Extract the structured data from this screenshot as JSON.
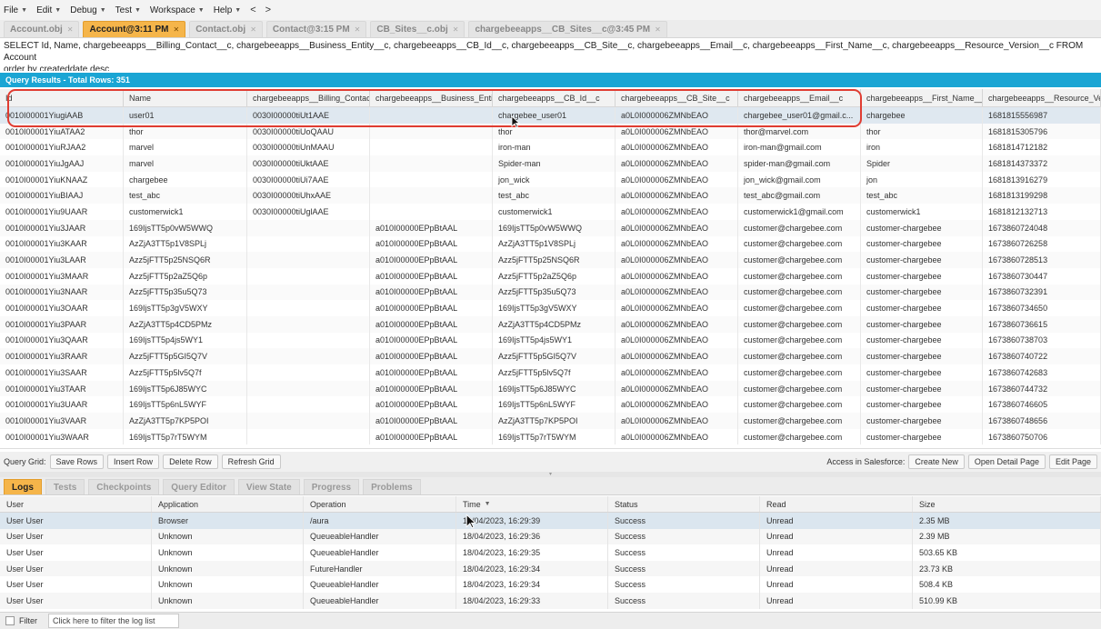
{
  "menu": {
    "items": [
      "File",
      "Edit",
      "Debug",
      "Test",
      "Workspace",
      "Help"
    ],
    "back": "<",
    "forward": ">"
  },
  "tabs": [
    {
      "label": "Account.obj",
      "active": false
    },
    {
      "label": "Account@3:11 PM",
      "active": true
    },
    {
      "label": "Contact.obj",
      "active": false
    },
    {
      "label": "Contact@3:15 PM",
      "active": false
    },
    {
      "label": "CB_Sites__c.obj",
      "active": false
    },
    {
      "label": "chargebeeapps__CB_Sites__c@3:45 PM",
      "active": false
    }
  ],
  "query": {
    "text": "SELECT Id, Name, chargebeeapps__Billing_Contact__c, chargebeeapps__Business_Entity__c, chargebeeapps__CB_Id__c, chargebeeapps__CB_Site__c, chargebeeapps__Email__c, chargebeeapps__First_Name__c, chargebeeapps__Resource_Version__c FROM Account\norder by createddate desc"
  },
  "results": {
    "header": "Query Results - Total Rows: 351",
    "columns": [
      "Id",
      "Name",
      "chargebeeapps__Billing_Contac",
      "chargebeeapps__Business_Enti",
      "chargebeeapps__CB_Id__c",
      "chargebeeapps__CB_Site__c",
      "chargebeeapps__Email__c",
      "chargebeeapps__First_Name__",
      "chargebeeapps__Resource_Ve"
    ],
    "rows": [
      [
        "0010I00001YiugiAAB",
        "user01",
        "0030I00000tiUt1AAE",
        "",
        "chargebee_user01",
        "a0L0I000006ZMNbEAO",
        "chargebee_user01@gmail.c...",
        "chargebee",
        "1681815556987"
      ],
      [
        "0010I00001YiuATAA2",
        "thor",
        "0030I00000tiUoQAAU",
        "",
        "thor",
        "a0L0I000006ZMNbEAO",
        "thor@marvel.com",
        "thor",
        "1681815305796"
      ],
      [
        "0010I00001YiuRJAA2",
        "marvel",
        "0030I00000tiUnMAAU",
        "",
        "iron-man",
        "a0L0I000006ZMNbEAO",
        "iron-man@gmail.com",
        "iron",
        "1681814712182"
      ],
      [
        "0010I00001YiuJgAAJ",
        "marvel",
        "0030I00000tiUktAAE",
        "",
        "Spider-man",
        "a0L0I000006ZMNbEAO",
        "spider-man@gmail.com",
        "Spider",
        "1681814373372"
      ],
      [
        "0010I00001YiuKNAAZ",
        "chargebee",
        "0030I00000tiUi7AAE",
        "",
        "jon_wick",
        "a0L0I000006ZMNbEAO",
        "jon_wick@gmail.com",
        "jon",
        "1681813916279"
      ],
      [
        "0010I00001YiuBIAAJ",
        "test_abc",
        "0030I00000tiUhxAAE",
        "",
        "test_abc",
        "a0L0I000006ZMNbEAO",
        "test_abc@gmail.com",
        "test_abc",
        "1681813199298"
      ],
      [
        "0010I00001Yiu9UAAR",
        "customerwick1",
        "0030I00000tiUglAAE",
        "",
        "customerwick1",
        "a0L0I000006ZMNbEAO",
        "customerwick1@gmail.com",
        "customerwick1",
        "1681812132713"
      ],
      [
        "0010I00001Yiu3JAAR",
        "169IjsTT5p0vW5WWQ",
        "",
        "a010I00000EPpBtAAL",
        "169IjsTT5p0vW5WWQ",
        "a0L0I000006ZMNbEAO",
        "customer@chargebee.com",
        "customer-chargebee",
        "1673860724048"
      ],
      [
        "0010I00001Yiu3KAAR",
        "AzZjA3TT5p1V8SPLj",
        "",
        "a010I00000EPpBtAAL",
        "AzZjA3TT5p1V8SPLj",
        "a0L0I000006ZMNbEAO",
        "customer@chargebee.com",
        "customer-chargebee",
        "1673860726258"
      ],
      [
        "0010I00001Yiu3LAAR",
        "Azz5jFTT5p25NSQ6R",
        "",
        "a010I00000EPpBtAAL",
        "Azz5jFTT5p25NSQ6R",
        "a0L0I000006ZMNbEAO",
        "customer@chargebee.com",
        "customer-chargebee",
        "1673860728513"
      ],
      [
        "0010I00001Yiu3MAAR",
        "Azz5jFTT5p2aZ5Q6p",
        "",
        "a010I00000EPpBtAAL",
        "Azz5jFTT5p2aZ5Q6p",
        "a0L0I000006ZMNbEAO",
        "customer@chargebee.com",
        "customer-chargebee",
        "1673860730447"
      ],
      [
        "0010I00001Yiu3NAAR",
        "Azz5jFTT5p35u5Q73",
        "",
        "a010I00000EPpBtAAL",
        "Azz5jFTT5p35u5Q73",
        "a0L0I000006ZMNbEAO",
        "customer@chargebee.com",
        "customer-chargebee",
        "1673860732391"
      ],
      [
        "0010I00001Yiu3OAAR",
        "169IjsTT5p3gV5WXY",
        "",
        "a010I00000EPpBtAAL",
        "169IjsTT5p3gV5WXY",
        "a0L0I000006ZMNbEAO",
        "customer@chargebee.com",
        "customer-chargebee",
        "1673860734650"
      ],
      [
        "0010I00001Yiu3PAAR",
        "AzZjA3TT5p4CD5PMz",
        "",
        "a010I00000EPpBtAAL",
        "AzZjA3TT5p4CD5PMz",
        "a0L0I000006ZMNbEAO",
        "customer@chargebee.com",
        "customer-chargebee",
        "1673860736615"
      ],
      [
        "0010I00001Yiu3QAAR",
        "169IjsTT5p4js5WY1",
        "",
        "a010I00000EPpBtAAL",
        "169IjsTT5p4js5WY1",
        "a0L0I000006ZMNbEAO",
        "customer@chargebee.com",
        "customer-chargebee",
        "1673860738703"
      ],
      [
        "0010I00001Yiu3RAAR",
        "Azz5jFTT5p5GI5Q7V",
        "",
        "a010I00000EPpBtAAL",
        "Azz5jFTT5p5GI5Q7V",
        "a0L0I000006ZMNbEAO",
        "customer@chargebee.com",
        "customer-chargebee",
        "1673860740722"
      ],
      [
        "0010I00001Yiu3SAAR",
        "Azz5jFTT5p5lv5Q7f",
        "",
        "a010I00000EPpBtAAL",
        "Azz5jFTT5p5lv5Q7f",
        "a0L0I000006ZMNbEAO",
        "customer@chargebee.com",
        "customer-chargebee",
        "1673860742683"
      ],
      [
        "0010I00001Yiu3TAAR",
        "169IjsTT5p6J85WYC",
        "",
        "a010I00000EPpBtAAL",
        "169IjsTT5p6J85WYC",
        "a0L0I000006ZMNbEAO",
        "customer@chargebee.com",
        "customer-chargebee",
        "1673860744732"
      ],
      [
        "0010I00001Yiu3UAAR",
        "169IjsTT5p6nL5WYF",
        "",
        "a010I00000EPpBtAAL",
        "169IjsTT5p6nL5WYF",
        "a0L0I000006ZMNbEAO",
        "customer@chargebee.com",
        "customer-chargebee",
        "1673860746605"
      ],
      [
        "0010I00001Yiu3VAAR",
        "AzZjA3TT5p7KP5POI",
        "",
        "a010I00000EPpBtAAL",
        "AzZjA3TT5p7KP5POI",
        "a0L0I000006ZMNbEAO",
        "customer@chargebee.com",
        "customer-chargebee",
        "1673860748656"
      ],
      [
        "0010I00001Yiu3WAAR",
        "169IjsTT5p7rT5WYM",
        "",
        "a010I00000EPpBtAAL",
        "169IjsTT5p7rT5WYM",
        "a0L0I000006ZMNbEAO",
        "customer@chargebee.com",
        "customer-chargebee",
        "1673860750706"
      ]
    ]
  },
  "query_toolbar": {
    "label": "Query Grid:",
    "save_rows": "Save Rows",
    "insert_row": "Insert Row",
    "delete_row": "Delete Row",
    "refresh_grid": "Refresh Grid",
    "access_label": "Access in Salesforce:",
    "create_new": "Create New",
    "open_detail": "Open Detail Page",
    "edit_page": "Edit Page"
  },
  "bottom_tabs": [
    {
      "label": "Logs",
      "active": true
    },
    {
      "label": "Tests",
      "active": false
    },
    {
      "label": "Checkpoints",
      "active": false
    },
    {
      "label": "Query Editor",
      "active": false
    },
    {
      "label": "View State",
      "active": false
    },
    {
      "label": "Progress",
      "active": false
    },
    {
      "label": "Problems",
      "active": false
    }
  ],
  "logs": {
    "columns": [
      "User",
      "Application",
      "Operation",
      "Time",
      "Status",
      "Read",
      "Size"
    ],
    "rows": [
      [
        "User User",
        "Browser",
        "/aura",
        "18/04/2023, 16:29:39",
        "Success",
        "Unread",
        "2.35 MB"
      ],
      [
        "User User",
        "Unknown",
        "QueueableHandler",
        "18/04/2023, 16:29:36",
        "Success",
        "Unread",
        "2.39 MB"
      ],
      [
        "User User",
        "Unknown",
        "QueueableHandler",
        "18/04/2023, 16:29:35",
        "Success",
        "Unread",
        "503.65 KB"
      ],
      [
        "User User",
        "Unknown",
        "FutureHandler",
        "18/04/2023, 16:29:34",
        "Success",
        "Unread",
        "23.73 KB"
      ],
      [
        "User User",
        "Unknown",
        "QueueableHandler",
        "18/04/2023, 16:29:34",
        "Success",
        "Unread",
        "508.4 KB"
      ],
      [
        "User User",
        "Unknown",
        "QueueableHandler",
        "18/04/2023, 16:29:33",
        "Success",
        "Unread",
        "510.99 KB"
      ]
    ]
  },
  "filter": {
    "label": "Filter",
    "placeholder": "Click here to filter the log list"
  },
  "colors": {
    "accent_tab": "#f5b54a",
    "results_header": "#1aa5d4",
    "highlight": "#e03c31"
  }
}
